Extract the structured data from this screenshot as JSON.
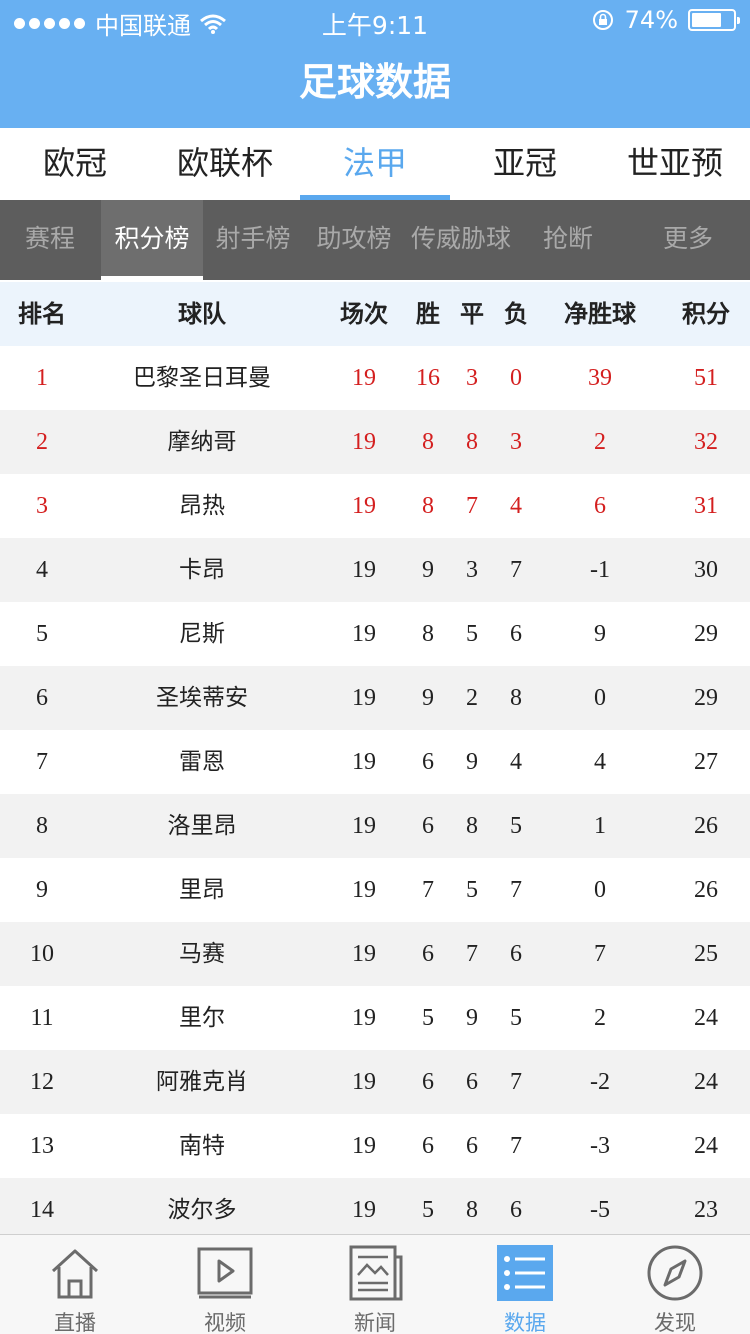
{
  "status": {
    "carrier": "中国联通",
    "time": "上午9:11",
    "battery": "74%",
    "battery_level": 0.74
  },
  "app": {
    "title": "足球数据"
  },
  "league_tabs": [
    {
      "label": "欧冠",
      "active": false
    },
    {
      "label": "欧联杯",
      "active": false
    },
    {
      "label": "法甲",
      "active": true
    },
    {
      "label": "亚冠",
      "active": false
    },
    {
      "label": "世亚预",
      "active": false
    }
  ],
  "sub_tabs": [
    {
      "label": "赛程",
      "active": false
    },
    {
      "label": "积分榜",
      "active": true
    },
    {
      "label": "射手榜",
      "active": false
    },
    {
      "label": "助攻榜",
      "active": false
    },
    {
      "label": "传威胁球",
      "active": false
    },
    {
      "label": "抢断",
      "active": false
    },
    {
      "label": "更多",
      "active": false
    }
  ],
  "table": {
    "headers": {
      "rank": "排名",
      "team": "球队",
      "played": "场次",
      "win": "胜",
      "draw": "平",
      "loss": "负",
      "gd": "净胜球",
      "pts": "积分"
    },
    "highlight_color": "#d41f1f",
    "rows": [
      {
        "rank": "1",
        "team": "巴黎圣日耳曼",
        "played": "19",
        "win": "16",
        "draw": "3",
        "loss": "0",
        "gd": "39",
        "pts": "51"
      },
      {
        "rank": "2",
        "team": "摩纳哥",
        "played": "19",
        "win": "8",
        "draw": "8",
        "loss": "3",
        "gd": "2",
        "pts": "32"
      },
      {
        "rank": "3",
        "team": "昂热",
        "played": "19",
        "win": "8",
        "draw": "7",
        "loss": "4",
        "gd": "6",
        "pts": "31"
      },
      {
        "rank": "4",
        "team": "卡昂",
        "played": "19",
        "win": "9",
        "draw": "3",
        "loss": "7",
        "gd": "-1",
        "pts": "30"
      },
      {
        "rank": "5",
        "team": "尼斯",
        "played": "19",
        "win": "8",
        "draw": "5",
        "loss": "6",
        "gd": "9",
        "pts": "29"
      },
      {
        "rank": "6",
        "team": "圣埃蒂安",
        "played": "19",
        "win": "9",
        "draw": "2",
        "loss": "8",
        "gd": "0",
        "pts": "29"
      },
      {
        "rank": "7",
        "team": "雷恩",
        "played": "19",
        "win": "6",
        "draw": "9",
        "loss": "4",
        "gd": "4",
        "pts": "27"
      },
      {
        "rank": "8",
        "team": "洛里昂",
        "played": "19",
        "win": "6",
        "draw": "8",
        "loss": "5",
        "gd": "1",
        "pts": "26"
      },
      {
        "rank": "9",
        "team": "里昂",
        "played": "19",
        "win": "7",
        "draw": "5",
        "loss": "7",
        "gd": "0",
        "pts": "26"
      },
      {
        "rank": "10",
        "team": "马赛",
        "played": "19",
        "win": "6",
        "draw": "7",
        "loss": "6",
        "gd": "7",
        "pts": "25"
      },
      {
        "rank": "11",
        "team": "里尔",
        "played": "19",
        "win": "5",
        "draw": "9",
        "loss": "5",
        "gd": "2",
        "pts": "24"
      },
      {
        "rank": "12",
        "team": "阿雅克肖",
        "played": "19",
        "win": "6",
        "draw": "6",
        "loss": "7",
        "gd": "-2",
        "pts": "24"
      },
      {
        "rank": "13",
        "team": "南特",
        "played": "19",
        "win": "6",
        "draw": "6",
        "loss": "7",
        "gd": "-3",
        "pts": "24"
      },
      {
        "rank": "14",
        "team": "波尔多",
        "played": "19",
        "win": "5",
        "draw": "8",
        "loss": "6",
        "gd": "-5",
        "pts": "23"
      }
    ]
  },
  "bottom_nav": [
    {
      "label": "直播",
      "icon": "house-icon",
      "active": false
    },
    {
      "label": "视频",
      "icon": "video-play-icon",
      "active": false
    },
    {
      "label": "新闻",
      "icon": "newspaper-icon",
      "active": false
    },
    {
      "label": "数据",
      "icon": "data-list-icon",
      "active": true
    },
    {
      "label": "发现",
      "icon": "compass-icon",
      "active": false
    }
  ],
  "colors": {
    "primary": "#68b0f2",
    "accent": "#5aa8ee",
    "subtab_bg": "#5d5d5d",
    "header_bg": "#ecf4fc"
  }
}
